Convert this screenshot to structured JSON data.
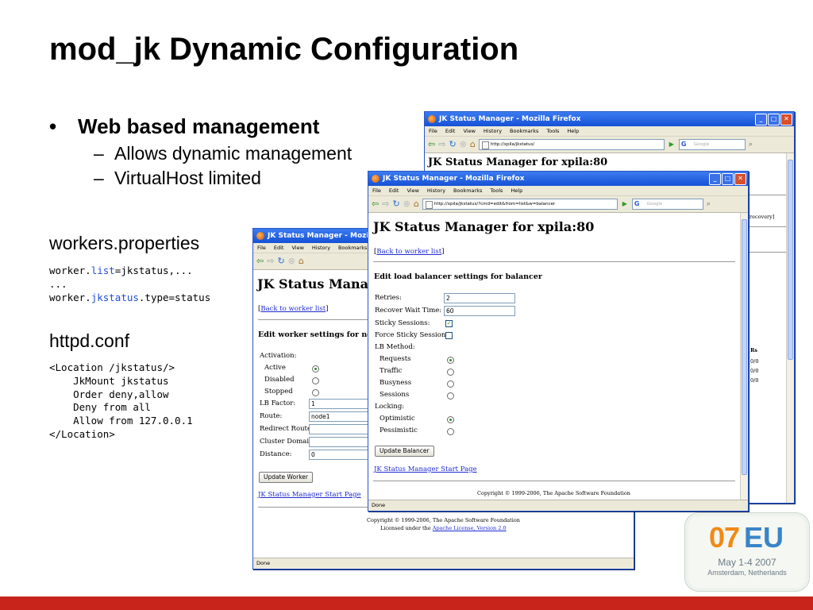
{
  "slide": {
    "title": "mod_jk Dynamic Configuration",
    "bullet_symbol": "•",
    "bullet": "Web based management",
    "dash": "–",
    "sub_bullets": [
      "Allows dynamic management",
      "VirtualHost limited"
    ],
    "workers_heading": "workers.properties",
    "workers_code": {
      "line1_prefix": "worker.",
      "line1_key": "list",
      "line1_suffix": "=jkstatus,...",
      "line2": "...",
      "line3_prefix": "worker.",
      "line3_key": "jkstatus",
      "line3_suffix": ".type=status"
    },
    "httpd_heading": "httpd.conf",
    "httpd_code": [
      "<Location /jkstatus/>",
      "    JkMount jkstatus",
      "    Order deny,allow",
      "    Deny from all",
      "    Allow from 127.0.0.1",
      "</Location>"
    ]
  },
  "browser_common": {
    "window_title": "JK Status Manager - Mozilla Firefox",
    "menu": [
      "File",
      "Edit",
      "View",
      "History",
      "Bookmarks",
      "Tools",
      "Help"
    ],
    "search_placeholder": "Google",
    "page_heading": "JK Status Manager for xpila:80",
    "status_done": "Done",
    "start_page_link": "JK Status Manager Start Page",
    "copyright": "Copyright © 1999-2006, The Apache Software Foundation",
    "licensed_prefix": "Licensed under the",
    "license_link": "Apache License, Version 2.0"
  },
  "window_back": {
    "url": "http://xpila/jkstatus/",
    "partial_text": "er recovery]",
    "col_header": "Rs",
    "col_values": [
      "0/0",
      "0/0",
      "0/0"
    ]
  },
  "window_mid": {
    "page_heading": "JK Status Mana",
    "back_link": "Back to worker list",
    "form_title": "Edit worker settings for no",
    "activation_label": "Activation:",
    "activation_options": [
      "Active",
      "Disabled",
      "Stopped"
    ],
    "activation_selected": "Active",
    "lb_factor_label": "LB Factor:",
    "lb_factor_value": "1",
    "route_label": "Route:",
    "route_value": "node1",
    "redirect_label": "Redirect Route:",
    "cluster_label": "Cluster Domain:",
    "distance_label": "Distance:",
    "distance_value": "0",
    "update_button": "Update Worker"
  },
  "window_front": {
    "url": "http://xpila/jkstatus/?cmd=edit&from=list&w=balancer",
    "back_link": "Back to worker list",
    "form_title": "Edit load balancer settings for balancer",
    "retries_label": "Retries:",
    "retries_value": "2",
    "recover_label": "Recover Wait Time:",
    "recover_value": "60",
    "sticky_label": "Sticky Sessions:",
    "sticky_checked": true,
    "force_sticky_label": "Force Sticky Sessions:",
    "force_sticky_checked": false,
    "lb_method_label": "LB Method:",
    "lb_methods": [
      "Requests",
      "Traffic",
      "Busyness",
      "Sessions"
    ],
    "lb_method_selected": "Requests",
    "locking_label": "Locking:",
    "locking_options": [
      "Optimistic",
      "Pessimistic"
    ],
    "locking_selected": "Optimistic",
    "update_button": "Update Balancer"
  },
  "logo": {
    "year": "07",
    "region": "EU",
    "dates": "May 1-4 2007",
    "place": "Amsterdam, Netherlands"
  },
  "colors": {
    "accent_red": "#c8241c",
    "xp_title_blue": "#1651d6",
    "code_blue": "#1f4fd8",
    "logo_orange": "#f08a16",
    "logo_blue": "#3a84c8"
  },
  "icons": [
    "firefox-icon",
    "back-icon",
    "forward-icon",
    "reload-icon",
    "stop-icon",
    "home-icon",
    "go-icon",
    "search-icon",
    "minimize-icon",
    "maximize-icon",
    "close-icon"
  ]
}
